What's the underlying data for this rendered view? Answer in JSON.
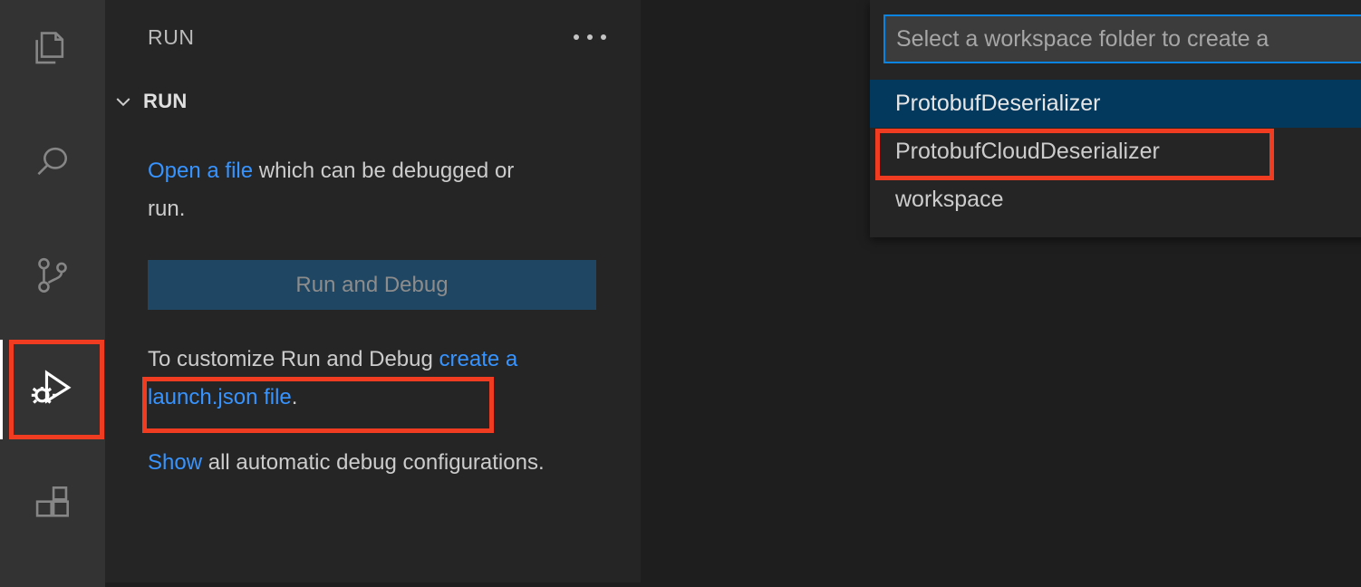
{
  "activity_bar": {
    "items": [
      {
        "name": "explorer",
        "icon": "files-icon",
        "active": false
      },
      {
        "name": "search",
        "icon": "search-icon",
        "active": false
      },
      {
        "name": "source-control",
        "icon": "source-control-icon",
        "active": false
      },
      {
        "name": "run-and-debug",
        "icon": "run-and-debug-icon",
        "active": true
      },
      {
        "name": "extensions",
        "icon": "extensions-icon",
        "active": false
      }
    ]
  },
  "sidebar": {
    "title": "RUN",
    "actions_icon": "more-actions-icon",
    "section": {
      "label": "RUN",
      "chevron_icon": "chevron-down-icon",
      "expanded": true
    },
    "open_file_paragraph": {
      "link": "Open a file",
      "rest": " which can be debugged or run."
    },
    "run_debug_button": {
      "label": "Run and Debug",
      "disabled": true
    },
    "customize_paragraph": {
      "lead": "To customize Run and Debug ",
      "link": "create a launch.json file",
      "trail": "."
    },
    "show_paragraph": {
      "link": "Show",
      "rest": " all automatic debug configurations."
    }
  },
  "quick_pick": {
    "input_placeholder": "Select a workspace folder to create a",
    "input_value": "",
    "items": [
      {
        "label": "ProtobufDeserializer",
        "selected": true
      },
      {
        "label": "ProtobufCloudDeserializer",
        "selected": false
      },
      {
        "label": "workspace",
        "selected": false
      }
    ]
  },
  "colors": {
    "annotation_red": "#f03c20",
    "link_blue": "#3794ff",
    "focus_border_blue": "#0a84e0",
    "selection_blue": "#04395e",
    "button_blue": "#1f4662",
    "activity_bar_bg": "#333333",
    "sidebar_bg": "#252526",
    "editor_bg": "#1e1e1e"
  },
  "annotations": [
    {
      "name": "activity-bar-run-debug-highlight"
    },
    {
      "name": "launch-json-link-highlight"
    },
    {
      "name": "quick-pick-protobufcloud-highlight"
    }
  ]
}
